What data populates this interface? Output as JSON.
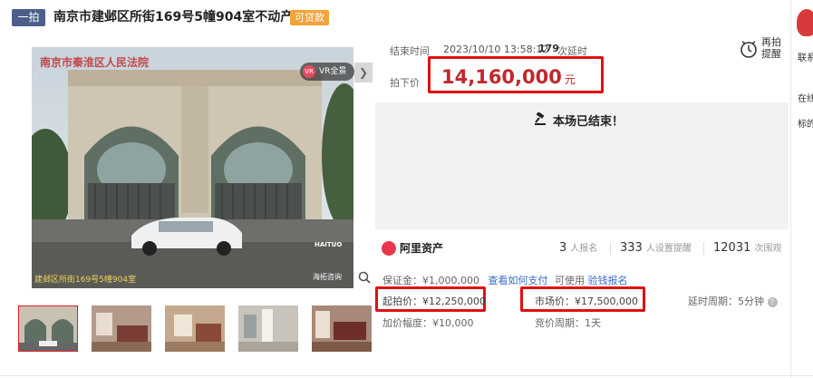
{
  "header": {
    "round_tag": "一拍",
    "title": "南京市建邺区所街169号5幢904室不动产",
    "loan_tag": "可贷款"
  },
  "gallery": {
    "vr_label": "VR全景",
    "image_watermark_top": "南京市秦淮区人民法院",
    "image_caption": "建邺区所街169号5幢904室",
    "image_logo_text": "HAITUO",
    "image_logo_sub": "海拓咨询",
    "thumbnails": [
      "thumb-1",
      "thumb-2",
      "thumb-3",
      "thumb-4",
      "thumb-5"
    ]
  },
  "auction": {
    "end_label": "结束时间",
    "end_time": "2023/10/10 13:58:12",
    "delay_count": "179",
    "delay_label": "次延时",
    "final_label": "拍下价",
    "final_price": "14,160,000",
    "final_unit": "元",
    "remind_line1": "再拍",
    "remind_line2": "提醒",
    "ended_text": "本场已结束！"
  },
  "platform": {
    "name": "阿里资产",
    "signups_num": "3",
    "signups_label": "人报名",
    "reminders_num": "333",
    "reminders_label": "人设置提醒",
    "views_num": "12031",
    "views_label": "次围观"
  },
  "details": {
    "deposit": "保证金：¥1,000,000",
    "how_to_pay": "查看如何支付",
    "can_use": "可使用",
    "scan_signup": "验钱报名",
    "start_price": "起拍价：¥12,250,000",
    "market_price": "市场价：¥17,500,000",
    "delay_period": "延时周期：5分钟",
    "increment": "加价幅度：¥10,000",
    "bid_period": "竞价周期：1天"
  },
  "right_strip": {
    "line1": "联系",
    "line2": "在线",
    "line3": "标的"
  },
  "colors": {
    "accent_red": "#c1272d",
    "highlight_box": "#e01010",
    "loan_tag": "#f2a33a",
    "round_tag": "#4c5f8a",
    "link": "#3a6bc9"
  }
}
